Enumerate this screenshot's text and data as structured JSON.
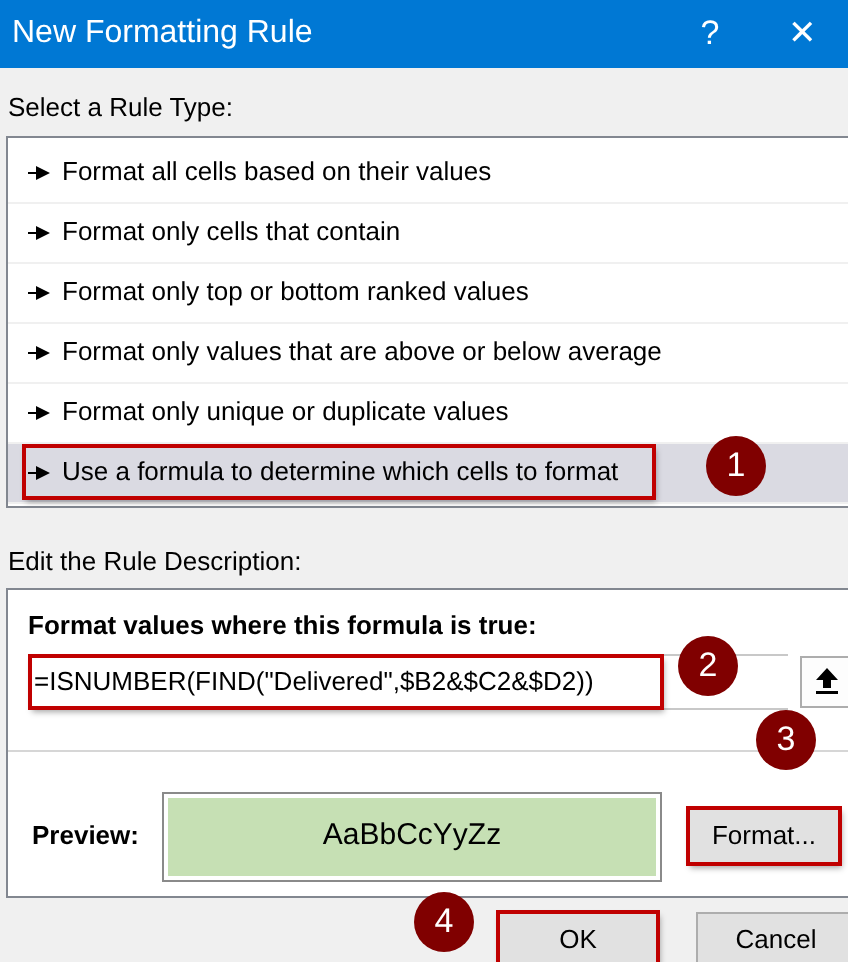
{
  "window": {
    "title": "New Formatting Rule",
    "help": "?",
    "close": "✕"
  },
  "rule_type": {
    "label": "Select a Rule Type:",
    "items": [
      {
        "label": "Format all cells based on their values",
        "selected": false,
        "highlighted": false
      },
      {
        "label": "Format only cells that contain",
        "selected": false,
        "highlighted": false
      },
      {
        "label": "Format only top or bottom ranked values",
        "selected": false,
        "highlighted": false
      },
      {
        "label": "Format only values that are above or below average",
        "selected": false,
        "highlighted": false
      },
      {
        "label": "Format only unique or duplicate values",
        "selected": false,
        "highlighted": false
      },
      {
        "label": "Use a formula to determine which cells to format",
        "selected": true,
        "highlighted": true
      }
    ]
  },
  "description": {
    "label": "Edit the Rule Description:",
    "formula_label": "Format values where this formula is true:",
    "formula": {
      "value": "=ISNUMBER(FIND(\"Delivered\",$B2&$C2&$D2))",
      "highlighted": true
    },
    "preview_label": "Preview:",
    "preview_text": "AaBbCcYyZz",
    "format_button": {
      "label": "Format...",
      "highlighted": true
    }
  },
  "buttons": [
    {
      "label": "OK",
      "highlighted": true
    },
    {
      "label": "Cancel",
      "highlighted": false
    }
  ],
  "callouts": [
    {
      "number": "1"
    },
    {
      "number": "2"
    },
    {
      "number": "3"
    },
    {
      "number": "4"
    }
  ]
}
